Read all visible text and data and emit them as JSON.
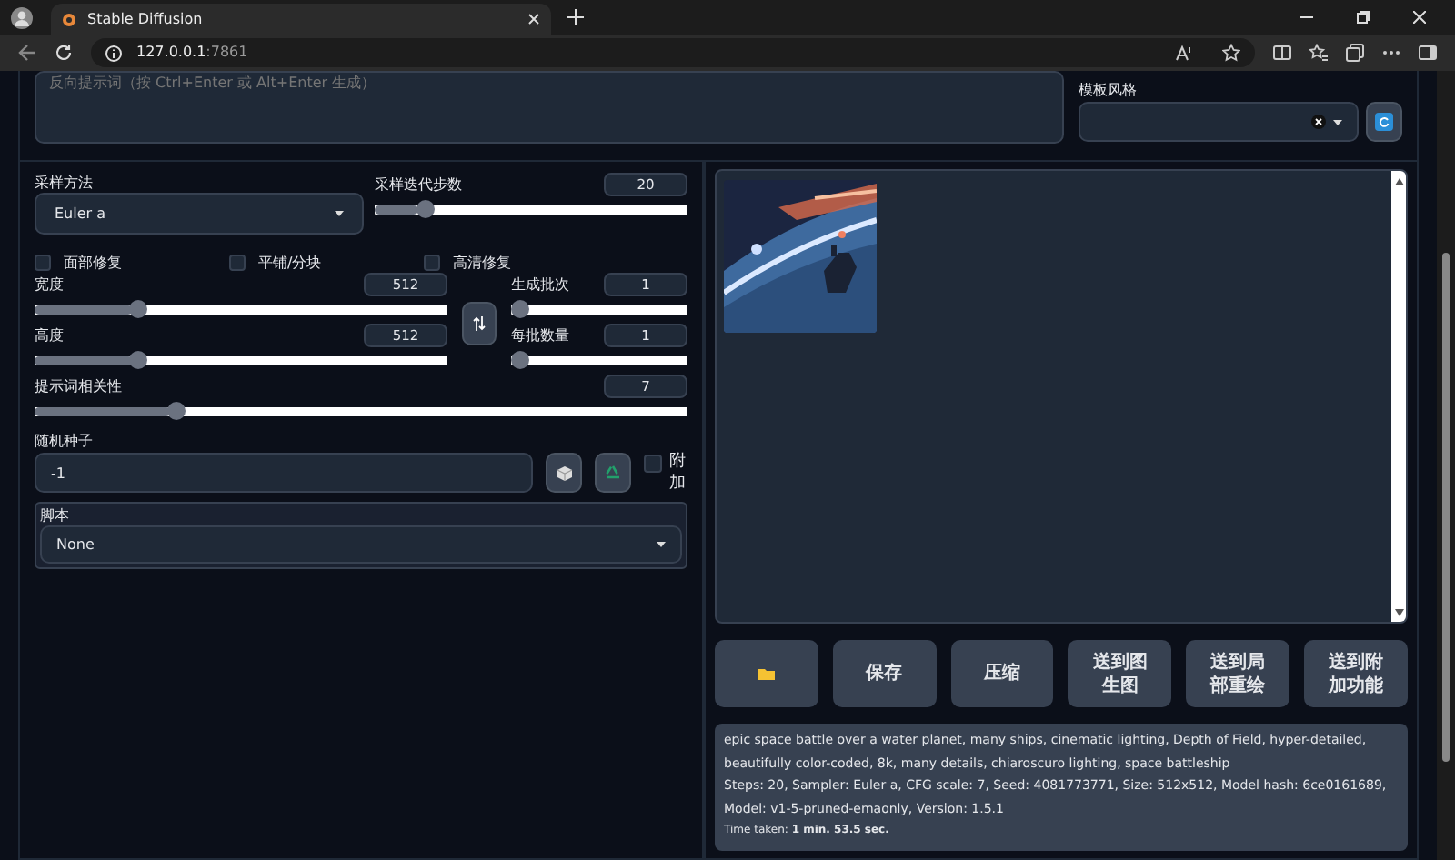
{
  "browser": {
    "tab_title": "Stable Diffusion",
    "url_host": "127.0.0.1",
    "url_port": ":7861"
  },
  "negative_prompt": {
    "placeholder": "反向提示词（按 Ctrl+Enter 或 Alt+Enter 生成）"
  },
  "style": {
    "label": "模板风格"
  },
  "sampler": {
    "label": "采样方法",
    "value": "Euler a"
  },
  "steps": {
    "label": "采样迭代步数",
    "value": "20",
    "level": 0.14
  },
  "checkboxes": [
    {
      "label": "面部修复",
      "checked": false
    },
    {
      "label": "平铺/分块",
      "checked": false
    },
    {
      "label": "高清修复",
      "checked": false
    }
  ],
  "size_sliders": [
    {
      "label": "宽度",
      "value": "512",
      "level": 0.24
    },
    {
      "label": "高度",
      "value": "512",
      "level": 0.24
    }
  ],
  "batch_sliders": [
    {
      "label": "生成批次",
      "value": "1",
      "level": 0
    },
    {
      "label": "每批数量",
      "value": "1",
      "level": 0
    }
  ],
  "cfg": {
    "label": "提示词相关性",
    "value": "7",
    "level": 0.21
  },
  "seed": {
    "label": "随机种子",
    "value": "-1",
    "extra": {
      "label": "附加",
      "checked": false
    }
  },
  "script": {
    "label": "脚本",
    "value": "None"
  },
  "actions": [
    {
      "kind": "folder"
    },
    {
      "kind": "text",
      "label": "保存"
    },
    {
      "kind": "text",
      "label": "压缩"
    },
    {
      "kind": "text",
      "label": "送到图生图"
    },
    {
      "kind": "text",
      "label": "送到局部重绘"
    },
    {
      "kind": "text",
      "label": "送到附加功能"
    }
  ],
  "info": {
    "prompt": "epic space battle over a water planet, many ships, cinematic lighting, Depth of Field, hyper-detailed, beautifully color-coded, 8k, many details, chiaroscuro lighting, space battleship",
    "params": "Steps: 20, Sampler: Euler a, CFG scale: 7, Seed: 4081773771, Size: 512x512, Model hash: 6ce0161689, Model: v1-5-pruned-emaonly, Version: 1.5.1",
    "time": "Time taken: **1 min. 53.5 sec.**"
  }
}
